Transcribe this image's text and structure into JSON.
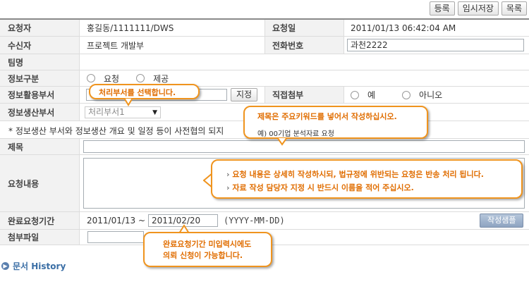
{
  "toolbar": {
    "register": "등록",
    "temp_save": "임시저장",
    "list": "목록"
  },
  "rows": {
    "requester": {
      "label": "요청자",
      "value": "홍길동/1111111/DWS"
    },
    "request_date": {
      "label": "요청일",
      "value": "2011/01/13 06:42:04 AM"
    },
    "recipient": {
      "label": "수신자",
      "value": "프로젝트 개발부"
    },
    "phone": {
      "label": "전화번호",
      "value": "과천2222"
    },
    "team": {
      "label": "팀명"
    },
    "info_type": {
      "label": "정보구분",
      "opt1": "요청",
      "opt2": "제공"
    },
    "usage_dept": {
      "label": "정보활용부서",
      "button": "지정"
    },
    "direct_attach": {
      "label": "직접첨부",
      "opt1": "예",
      "opt2": "아니오"
    },
    "producing_dept": {
      "label": "정보생산부서",
      "selected": "처리부서1"
    },
    "notice": "* 정보생산 부서와 정보생산 개요 및 일정 등이 사전협의 되지",
    "title": {
      "label": "제목"
    },
    "content": {
      "label": "요청내용"
    },
    "due_period": {
      "label": "완료요청기간",
      "start": "2011/01/13 ~",
      "end": "2011/02/20",
      "format": "(YYYY-MM-DD)",
      "sample_button": "작성샘플"
    },
    "attachment": {
      "label": "첨부파일"
    }
  },
  "tooltips": {
    "select_dept": "처리부서를 선택합니다.",
    "title_hint": "제목은 주요키워드를 넣어서 작성하십시오.",
    "title_example": "예) 00기업 분석자료 요청",
    "content_hint1": "요청 내용은 상세히 작성하시되, 법규정에 위반되는 요청은 반송 처리 됩니다.",
    "content_hint2": "자료 작성 담당자 지정 시 반드시 이름을 적어 주십시오.",
    "due_hint1": "완료요청기간 미입력시에도",
    "due_hint2": "의뢰 신청이 가능합니다."
  },
  "history": {
    "label": "문서 History"
  },
  "colors": {
    "tooltip_border": "#f0941e",
    "tooltip_text": "#e06d00",
    "label_bg": "#f2f2f2",
    "history_text": "#3a6ea5"
  }
}
